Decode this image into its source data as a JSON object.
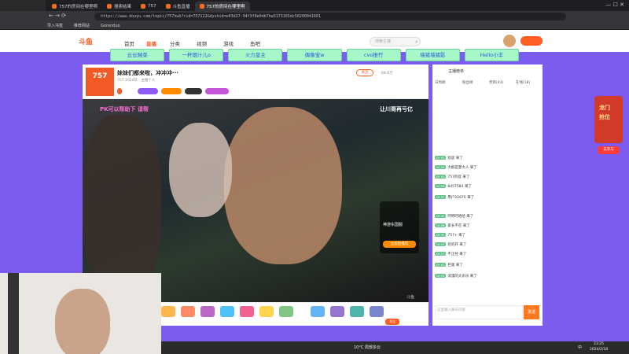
{
  "browser": {
    "tabs": [
      {
        "label": "757的房间在哪里啊"
      },
      {
        "label": "搜索结果"
      },
      {
        "label": "757"
      },
      {
        "label": "斗鱼直播"
      },
      {
        "label": "757的房间在哪里啊"
      }
    ],
    "url": "https://www.douyu.com/topic/757hwb?rid=757122&dyshid=e03d27-94f3f8e0db7ba5173165dc58200041601",
    "bookmarks": [
      "导入书签",
      "推荐网站",
      "Gorenduo"
    ]
  },
  "site": {
    "logo": "斗鱼",
    "nav": [
      "首页",
      "直播",
      "分类",
      "视频",
      "游戏",
      "鱼吧"
    ],
    "search_placeholder": "搜索主播"
  },
  "banner_chips": [
    "云云贼菜",
    "一杯烟汁儿o",
    "火力皇主",
    "偶像宝w",
    "cvo推竹",
    "墙猪墙猪影",
    "Hello小丰"
  ],
  "room": {
    "avatar_text": "757",
    "title": "妹妹们都来啦，冲冲冲···",
    "meta_line": "757 2024年 · 主播个人",
    "follow_count": "68.8万",
    "video_overlay_left": "PK可以帮助下 请帮",
    "video_overlay_right": "让川哥再亏亿",
    "watermark": "斗鱼",
    "promo_title": "神游东国服",
    "promo_button": "立即直播玩",
    "follow_button": "关注"
  },
  "chat": {
    "header": "主播榜单",
    "tabs": [
      "日周榜",
      "粉丝榜",
      "贵宾(43)",
      "在线(18)"
    ],
    "messages": [
      {
        "lv": "LV 52",
        "text": "欢迎 来了"
      },
      {
        "lv": "LV 43",
        "text": "大鹅是夏大人 来了"
      },
      {
        "lv": "LV 31",
        "text": "757的官 来了"
      },
      {
        "lv": "LV 29",
        "text": "8457584 来了"
      },
      {
        "lv": "LV 37",
        "text": "用户21670 来了"
      },
      {
        "lv": "LV 45",
        "text": "呵呵呵哈哈 来了"
      },
      {
        "lv": "LV 28",
        "text": "家长不在 来了"
      },
      {
        "lv": "LV 30",
        "text": "757+ 来了"
      },
      {
        "lv": "LV 22",
        "text": "玩的开 来了"
      },
      {
        "lv": "LV 27",
        "text": "不正经 来了"
      },
      {
        "lv": "LV 41",
        "text": "巨富 来了"
      },
      {
        "lv": "LV 33",
        "text": "浪漫的大乐乐 来了"
      }
    ],
    "input_placeholder": "这里输入聊天内容",
    "send_label": "发送"
  },
  "promo": {
    "title": "龙门",
    "subtitle": "抢位",
    "button": "去参与"
  },
  "taskbar": {
    "weather": "10°C 局部多云",
    "lang": "中",
    "time": "23:25",
    "date": "2024/2/18"
  },
  "colors": {
    "brand": "#ff5d23",
    "accent_purple": "#7c5cf0",
    "chip_green": "#a7f7c9"
  }
}
